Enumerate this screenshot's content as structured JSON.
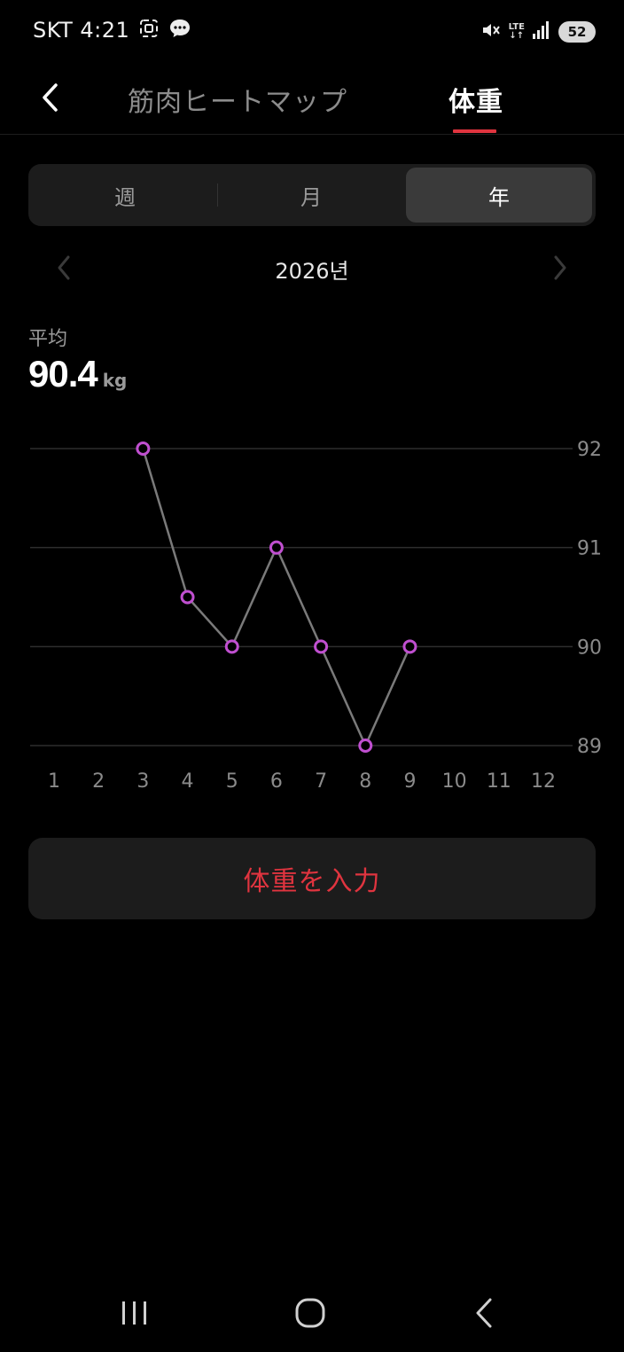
{
  "status_bar": {
    "carrier_time": "SKT 4:21",
    "network": "LTE",
    "battery": "52",
    "icons": [
      "screenshot-icon",
      "chat-icon",
      "mute-icon",
      "lte-icon",
      "signal-icon",
      "battery-icon"
    ]
  },
  "header": {
    "tabs": [
      {
        "label": "筋肉ヒートマップ",
        "active": false
      },
      {
        "label": "体重",
        "active": true
      }
    ],
    "accent_color": "#e0343f"
  },
  "segmented": {
    "options": [
      "週",
      "月",
      "年"
    ],
    "selected": "年"
  },
  "period": {
    "label": "2026년"
  },
  "average": {
    "label": "平均",
    "value": "90.4",
    "unit": "kg"
  },
  "chart_data": {
    "type": "line",
    "x": [
      3,
      4,
      5,
      6,
      7,
      8,
      9
    ],
    "y": [
      92,
      90.5,
      90,
      91,
      90,
      89,
      90
    ],
    "x_ticks": [
      "1",
      "2",
      "3",
      "4",
      "5",
      "6",
      "7",
      "8",
      "9",
      "10",
      "11",
      "12"
    ],
    "y_ticks": [
      "92",
      "91",
      "90",
      "89"
    ],
    "ylim": [
      89,
      92
    ],
    "xlim": [
      1,
      12
    ],
    "grid": true,
    "line_color": "#7a7a7a",
    "marker_color": "#c04fd0"
  },
  "input_button": {
    "label": "体重を入力"
  }
}
